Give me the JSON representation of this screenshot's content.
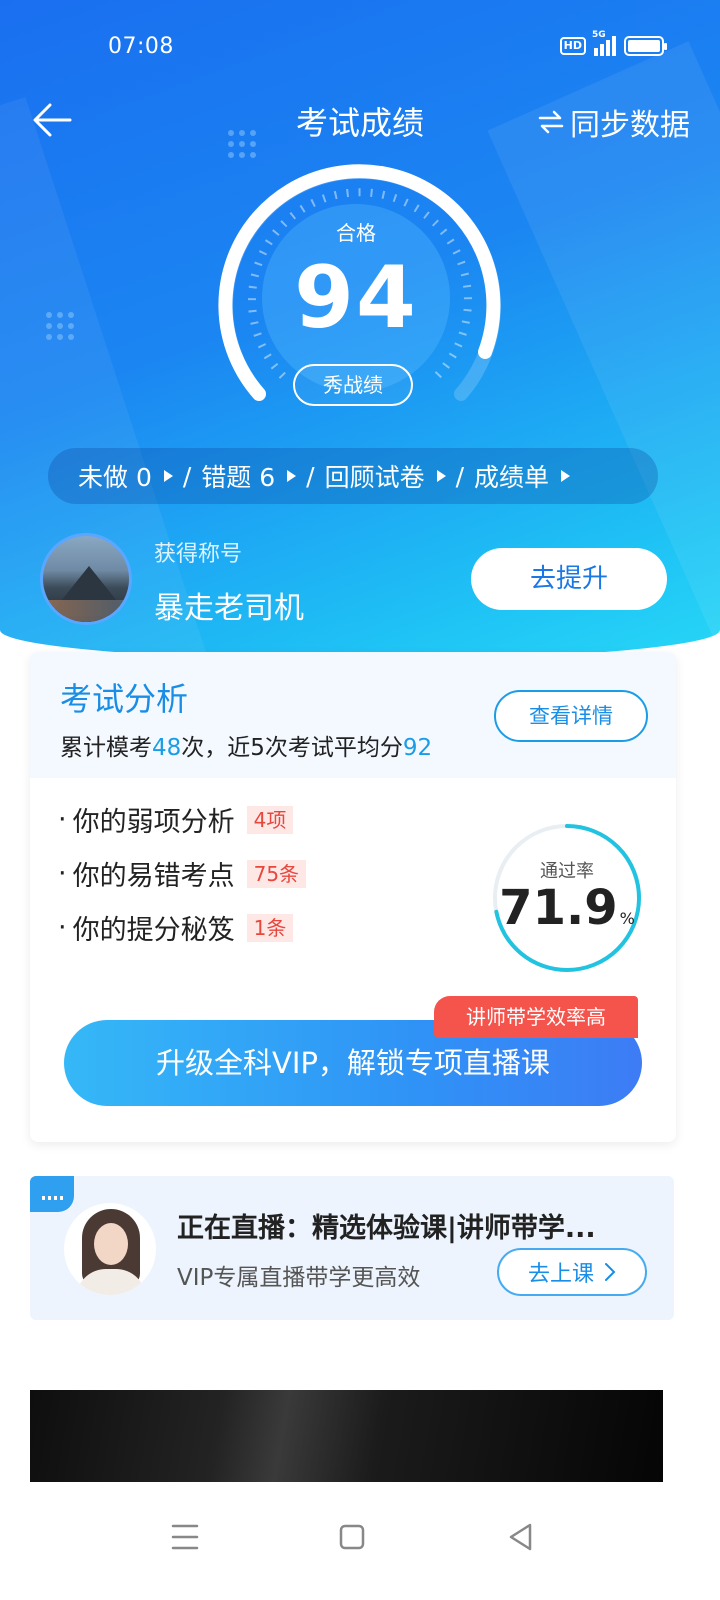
{
  "status_bar": {
    "time": "07:08",
    "hd": "HD",
    "network": "5G"
  },
  "header": {
    "title": "考试成绩",
    "sync_label": "同步数据"
  },
  "score": {
    "status": "合格",
    "value": "94",
    "share_label": "秀战绩"
  },
  "quick_links": [
    {
      "label": "未做 0"
    },
    {
      "label": "错题  6"
    },
    {
      "label": "回顾试卷"
    },
    {
      "label": "成绩单"
    }
  ],
  "quick_sep": "/",
  "title_row": {
    "earned_label": "获得称号",
    "title_name": "暴走老司机",
    "improve_label": "去提升"
  },
  "analysis": {
    "title": "考试分析",
    "sub_prefix": "累计模考",
    "total_exams": "48",
    "sub_mid": "次，近5次考试平均分",
    "avg_score": "92",
    "details_label": "查看详情",
    "items": [
      {
        "bullet": "·",
        "label": "你的弱项分析",
        "tag": "4项"
      },
      {
        "bullet": "·",
        "label": "你的易错考点",
        "tag": "75条"
      },
      {
        "bullet": "·",
        "label": "你的提分秘笈",
        "tag": "1条"
      }
    ],
    "pass_rate_label": "通过率",
    "pass_rate_value": "71.9",
    "pass_rate_unit": "%",
    "vip_label": "升级全科VIP，解锁专项直播课",
    "vip_tag": "讲师带学效率高"
  },
  "live": {
    "title": "正在直播：精选体验课|讲师带学...",
    "subtitle": "VIP专属直播带学更高效",
    "button_label": "去上课"
  },
  "colors": {
    "accent": "#1a8ee6",
    "ring": "#22c3e0",
    "tag_red": "#e8473d"
  }
}
